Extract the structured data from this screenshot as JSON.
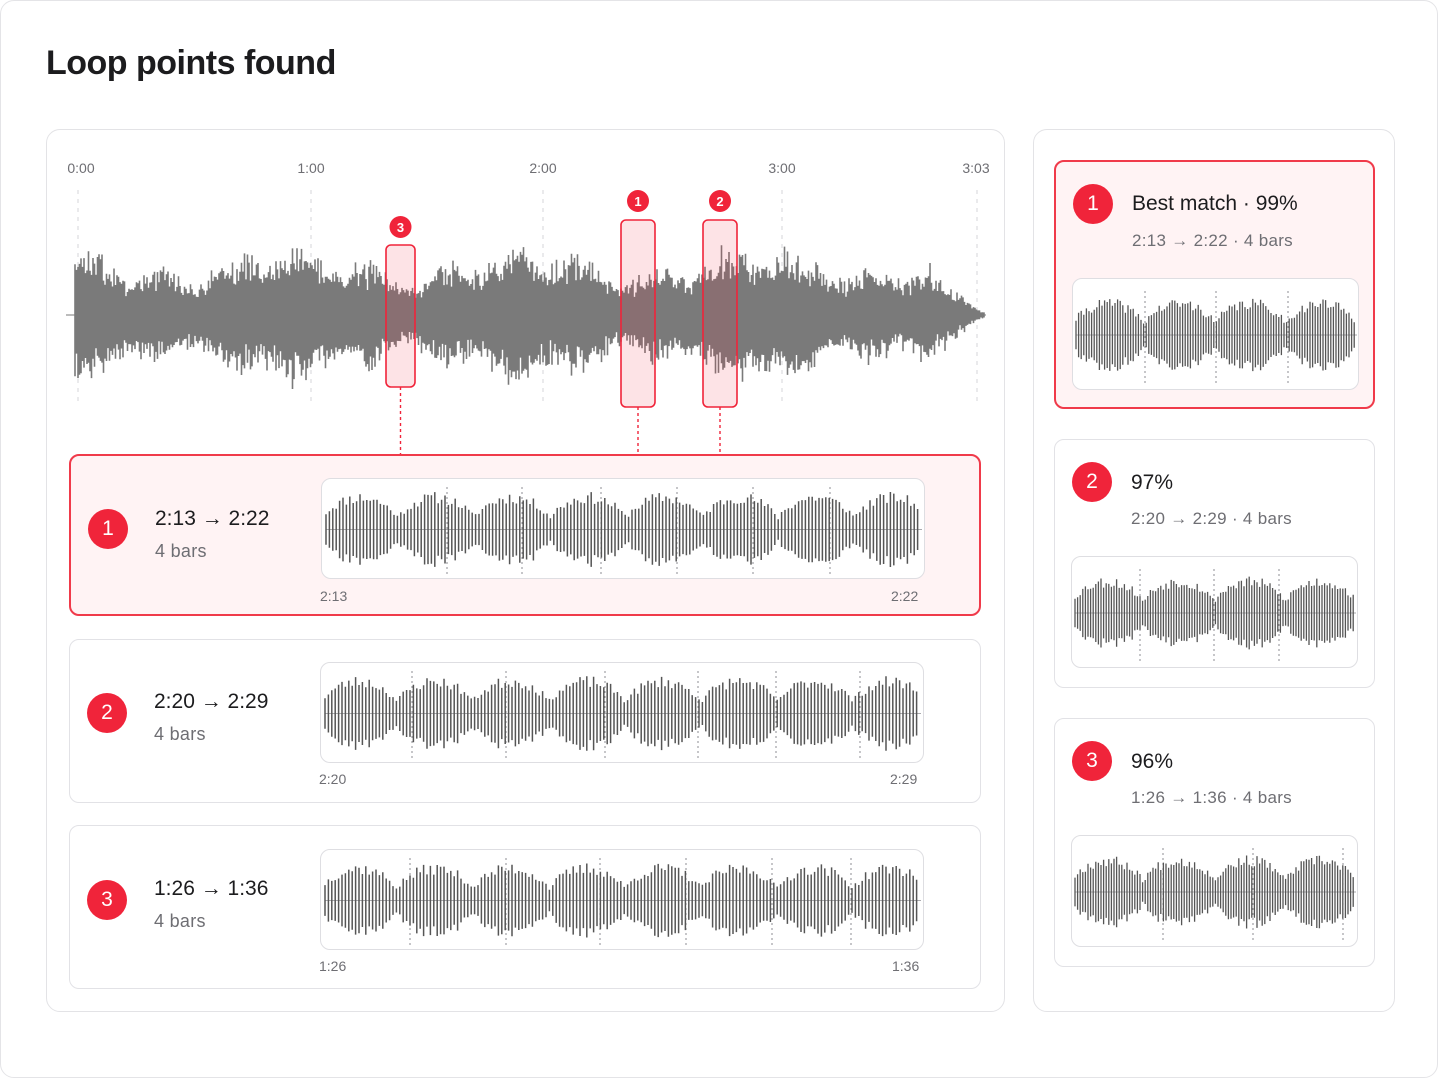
{
  "page": {
    "title": "Loop points found"
  },
  "timeline": {
    "ticks": [
      "0:00",
      "1:00",
      "2:00",
      "3:00",
      "3:03"
    ],
    "markers": [
      {
        "number": "3",
        "start": "1:26",
        "end": "1:36"
      },
      {
        "number": "1",
        "start": "2:13",
        "end": "2:22"
      },
      {
        "number": "2",
        "start": "2:20",
        "end": "2:29"
      }
    ]
  },
  "loops": [
    {
      "number": "1",
      "range": "2:13 → 2:22",
      "bars": "4 bars",
      "start_label": "2:13",
      "end_label": "2:22",
      "selected": true
    },
    {
      "number": "2",
      "range": "2:20 → 2:29",
      "bars": "4 bars",
      "start_label": "2:20",
      "end_label": "2:29",
      "selected": false
    },
    {
      "number": "3",
      "range": "1:26 → 1:36",
      "bars": "4 bars",
      "start_label": "1:26",
      "end_label": "1:36",
      "selected": false
    }
  ],
  "matches": [
    {
      "number": "1",
      "title": "Best match · 99%",
      "detail": "2:13 → 2:22 · 4 bars",
      "selected": true
    },
    {
      "number": "2",
      "title": "97%",
      "detail": "2:20 → 2:29 · 4 bars",
      "selected": false
    },
    {
      "number": "3",
      "title": "96%",
      "detail": "1:26 → 1:36 · 4 bars",
      "selected": false
    }
  ],
  "colors": {
    "accent": "#f0243a",
    "waveform": "#7a7a7a",
    "selected_bg": "#fff3f4"
  }
}
